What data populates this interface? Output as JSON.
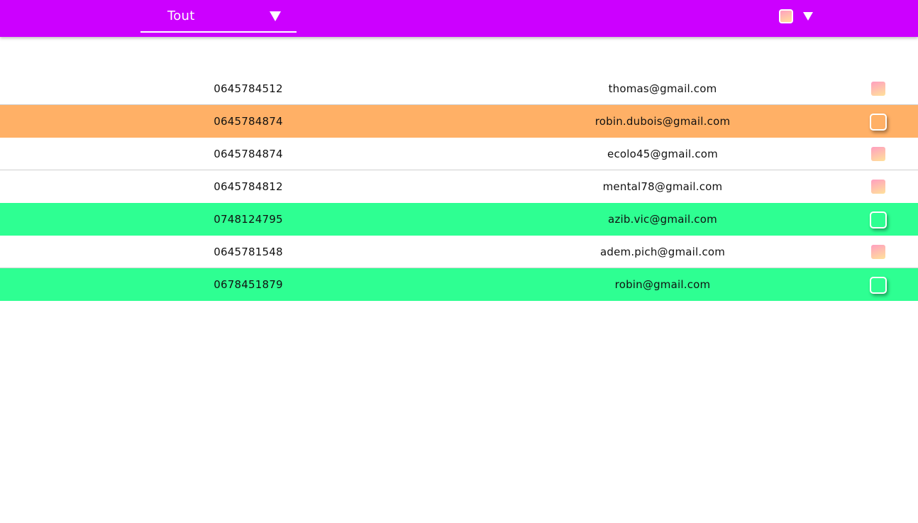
{
  "header": {
    "filter_value": "Tout",
    "filter_icon": "triangle-down-icon",
    "color_picker_icon": "triangle-down-icon",
    "background_color": "#cc00ff",
    "swatch_gradient": [
      "#ff9fc0",
      "#ffe29a"
    ]
  },
  "contacts": [
    {
      "phone": "0645784512",
      "email": "thomas@gmail.com",
      "row_color": "#ffffff",
      "swatch": "gradient"
    },
    {
      "phone": "0645784874",
      "email": "robin.dubois@gmail.com",
      "row_color": "#ffb066",
      "swatch": "outlined"
    },
    {
      "phone": "0645784874",
      "email": "ecolo45@gmail.com",
      "row_color": "#ffffff",
      "swatch": "gradient"
    },
    {
      "phone": "0645784812",
      "email": "mental78@gmail.com",
      "row_color": "#ffffff",
      "swatch": "gradient"
    },
    {
      "phone": "0748124795",
      "email": "azib.vic@gmail.com",
      "row_color": "#2eff92",
      "swatch": "outlined"
    },
    {
      "phone": "0645781548",
      "email": "adem.pich@gmail.com",
      "row_color": "#ffffff",
      "swatch": "gradient"
    },
    {
      "phone": "0678451879",
      "email": "robin@gmail.com",
      "row_color": "#2eff92",
      "swatch": "outlined"
    }
  ]
}
